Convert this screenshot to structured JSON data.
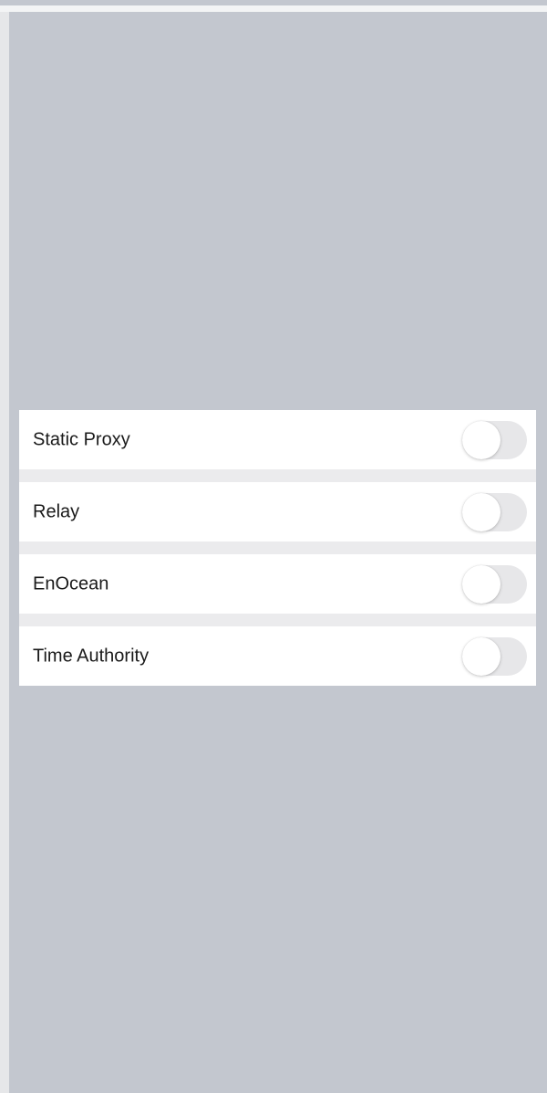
{
  "options": [
    {
      "label": "Static Proxy",
      "enabled": false
    },
    {
      "label": "Relay",
      "enabled": false
    },
    {
      "label": "EnOcean",
      "enabled": false
    },
    {
      "label": "Time Authority",
      "enabled": false
    }
  ],
  "colors": {
    "overlay": "#c3c7cf",
    "row_background": "#ffffff",
    "toggle_off_track": "#e7e7e9",
    "label_text": "#1a1a1a"
  }
}
